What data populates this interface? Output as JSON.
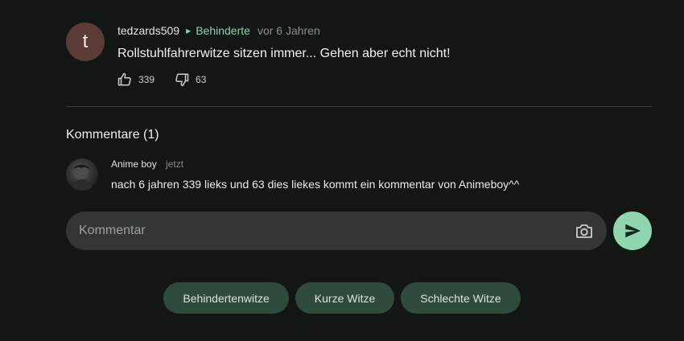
{
  "post": {
    "avatar_letter": "t",
    "author": "tedzards509",
    "category": "Behinderte",
    "time": "vor 6 Jahren",
    "text": "Rollstuhlfahrerwitze sitzen immer... Gehen aber echt nicht!",
    "likes": "339",
    "dislikes": "63"
  },
  "comments": {
    "title": "Kommentare (1)",
    "items": [
      {
        "author": "Anime boy",
        "time": "jetzt",
        "text": "nach 6 jahren 339 lieks und 63 dies liekes kommt ein kommentar von Animeboy^^"
      }
    ]
  },
  "comment_input": {
    "placeholder": "Kommentar"
  },
  "icons": {
    "like": "thumb-up-icon",
    "dislike": "thumb-down-icon",
    "camera": "camera-icon",
    "send": "send-icon"
  },
  "tags": [
    "Behindertenwitze",
    "Kurze Witze",
    "Schlechte Witze"
  ],
  "colors": {
    "accent": "#8fd6ae",
    "category": "#8fd0ac",
    "background": "#121714",
    "tag_bg": "#2f4b3b",
    "input_bg": "#323734"
  }
}
